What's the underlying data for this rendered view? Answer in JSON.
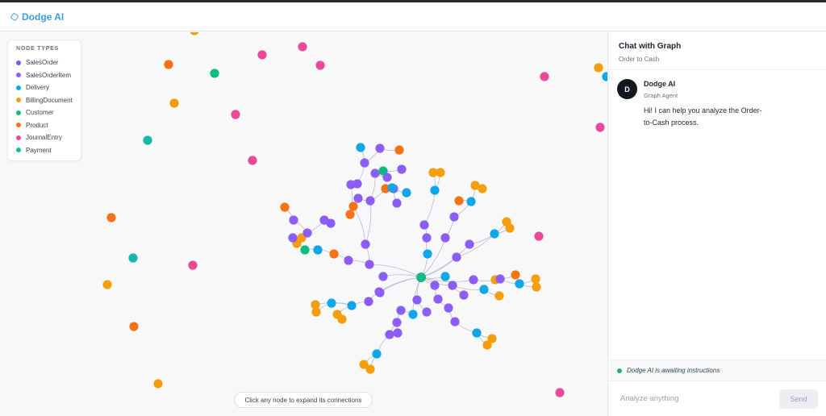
{
  "app": {
    "name": "Dodge AI",
    "icon": "hexagon-logo-icon"
  },
  "legend": {
    "title": "NODE TYPES",
    "items": [
      {
        "label": "SalesOrder",
        "color": "#6e62e6"
      },
      {
        "label": "SalesOrderItem",
        "color": "#8b5cf6"
      },
      {
        "label": "Delivery",
        "color": "#0ea5e9"
      },
      {
        "label": "BillingDocument",
        "color": "#f59e0b"
      },
      {
        "label": "Customer",
        "color": "#10b981"
      },
      {
        "label": "Product",
        "color": "#f97316"
      },
      {
        "label": "JournalEntry",
        "color": "#ec4899"
      },
      {
        "label": "Payment",
        "color": "#14b8a6"
      }
    ]
  },
  "graph": {
    "hint": "Click any node to expand its connections",
    "edge_color": "#b8bcc6"
  },
  "chat": {
    "title": "Chat with Graph",
    "subtitle": "Order to Cash",
    "message": {
      "avatar": "D",
      "name": "Dodge AI",
      "role": "Graph Agent",
      "text": "Hi! I can help you analyze the Order-to-Cash process."
    },
    "status": "Dodge AI is awaiting instructions",
    "input_placeholder": "Analyze anything",
    "send_label": "Send"
  }
}
